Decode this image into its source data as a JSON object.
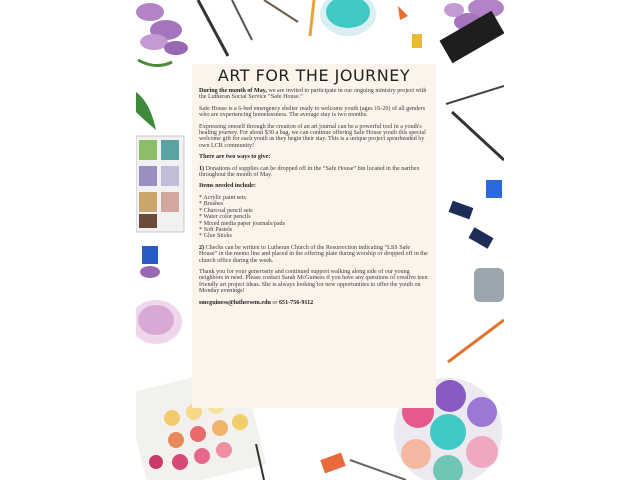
{
  "title": "ART FOR THE JOURNEY",
  "intro": {
    "lead_bold": "During the month of May,",
    "lead_rest": " we are invited to participate in our ongoing ministry project with the Lutheran Social Service “Safe House.”"
  },
  "safe_house_text": "Safe House is a 6-bed emergency shelter ready to welcome youth (ages 16-20) of all genders who are experiencing homelessness.  The average stay is two months.",
  "journal_text": "Expressing oneself through the creation of an art journal can be a powerful tool in a youth's healing journey.  For about $30 a bag, we can continue offering Safe House youth this special welcome gift for each youth as they begin their stay.  This is a unique project spearheaded by own LCR community!",
  "ways_heading": "There are two ways to give:",
  "way1": {
    "num": "1)",
    "text": " Donations of supplies can be dropped off in the “Safe House” bin located in the narthex throughout the month of May."
  },
  "items_heading": "Items needed include:",
  "items": [
    "* Acrylic paint sets",
    "* Brushes",
    "* Charcoal pencil sets",
    "* Water color pencils",
    "* Mixed media paper journals/pads",
    "* Soft Pastels",
    "* Glue Sticks"
  ],
  "way2": {
    "num": "2)",
    "text": " Checks can be written to Lutheran Church of the Resurrection indicating “LSS Safe House” in the memo line and placed in the offering plate during worship or dropped off in the church office during the week."
  },
  "thanks_text": "Thank you for your generosity and continued support walking along side of our young neighbors in need.  Please contact Sarah McGuiness if you have any questions of creative teen friendly art project ideas.  She is always looking for new opportunities to offer the youth on Monday evenings!",
  "contact": {
    "email": "smcguiness@luthersem.edu",
    "sep": " or ",
    "phone": "651-756-9112"
  },
  "colors": {
    "panel": "#fbf4ea",
    "lavender": "#b483c7",
    "teal": "#3fc9c4",
    "pink": "#e55a8c"
  }
}
